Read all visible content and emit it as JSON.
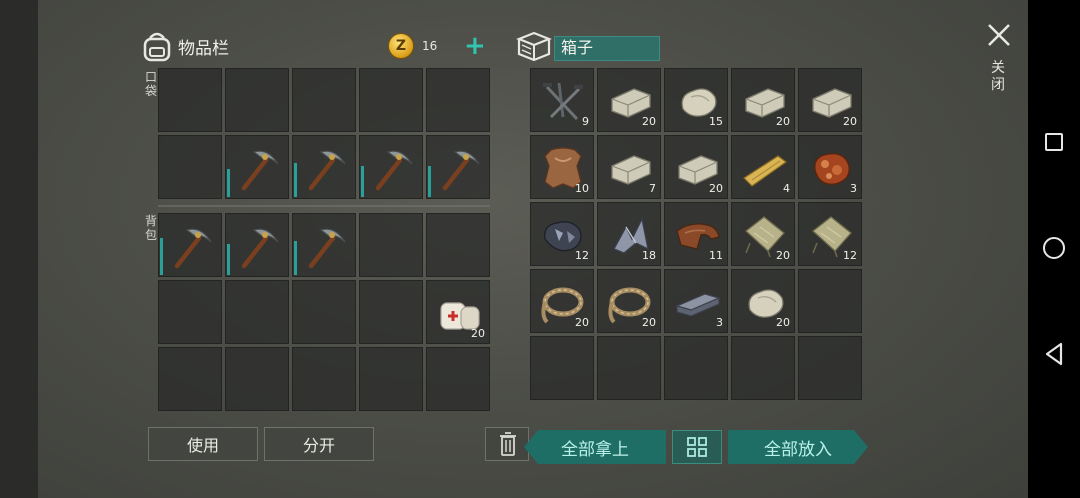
{
  "inventory": {
    "title": "物品栏",
    "pocket_label": "口袋",
    "backpack_label": "背包",
    "coins": {
      "symbol": "Z",
      "count": "16"
    }
  },
  "box": {
    "title": "箱子"
  },
  "close": {
    "label": "关闭"
  },
  "buttons": {
    "use": "使用",
    "split": "分开",
    "take_all": "全部拿上",
    "put_all": "全部放入"
  },
  "pocket_slots": [
    {},
    {},
    {},
    {},
    {},
    {},
    {
      "icon": "pickaxe-icon",
      "dur": 0.45
    },
    {
      "icon": "pickaxe-icon",
      "dur": 0.55
    },
    {
      "icon": "pickaxe-icon",
      "dur": 0.5
    },
    {
      "icon": "pickaxe-icon",
      "dur": 0.5
    }
  ],
  "backpack_slots": [
    {
      "icon": "pickaxe-icon",
      "dur": 0.6
    },
    {
      "icon": "pickaxe-icon",
      "dur": 0.5
    },
    {
      "icon": "pickaxe-icon",
      "dur": 0.55
    },
    {},
    {},
    {},
    {},
    {},
    {},
    {
      "icon": "bandage-icon",
      "qty": "20"
    },
    {},
    {},
    {},
    {},
    {}
  ],
  "box_slots": [
    {
      "icon": "nails-icon",
      "qty": "9"
    },
    {
      "icon": "stone-block-icon",
      "qty": "20"
    },
    {
      "icon": "stone-icon",
      "qty": "15"
    },
    {
      "icon": "stone-block-icon",
      "qty": "20"
    },
    {
      "icon": "stone-block-icon",
      "qty": "20"
    },
    {
      "icon": "hide-icon",
      "qty": "10"
    },
    {
      "icon": "stone-block-icon",
      "qty": "7"
    },
    {
      "icon": "stone-block-icon",
      "qty": "20"
    },
    {
      "icon": "plank-icon",
      "qty": "4"
    },
    {
      "icon": "meat-icon",
      "qty": "3"
    },
    {
      "icon": "ore-icon",
      "qty": "12"
    },
    {
      "icon": "metal-scrap-icon",
      "qty": "18"
    },
    {
      "icon": "leather-icon",
      "qty": "11"
    },
    {
      "icon": "cloth-icon",
      "qty": "20"
    },
    {
      "icon": "cloth-icon",
      "qty": "12"
    },
    {
      "icon": "rope-icon",
      "qty": "20"
    },
    {
      "icon": "rope-icon",
      "qty": "20"
    },
    {
      "icon": "iron-ingot-icon",
      "qty": "3"
    },
    {
      "icon": "stone-icon",
      "qty": "20"
    },
    {},
    {},
    {},
    {},
    {},
    {}
  ],
  "colors": {
    "accent": "#1f6e66",
    "durability": "#29a19a"
  }
}
